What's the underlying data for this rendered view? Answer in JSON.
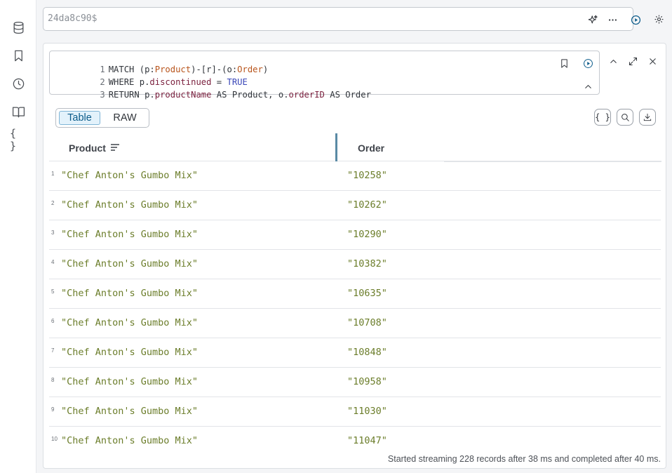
{
  "editor": {
    "value": "24da8c90$"
  },
  "query": {
    "lines": [
      {
        "n": "1",
        "parts": [
          {
            "t": "MATCH (p:",
            "c": "kw"
          },
          {
            "t": "Product",
            "c": "lbl"
          },
          {
            "t": ")-[r]-(o:",
            "c": "kw"
          },
          {
            "t": "Order",
            "c": "lbl"
          },
          {
            "t": ")",
            "c": "kw"
          }
        ]
      },
      {
        "n": "2",
        "parts": [
          {
            "t": "WHERE p.",
            "c": "kw"
          },
          {
            "t": "discontinued",
            "c": "prop"
          },
          {
            "t": " = ",
            "c": "kw"
          },
          {
            "t": "TRUE",
            "c": "bool"
          }
        ]
      },
      {
        "n": "3",
        "parts": [
          {
            "t": "RETURN p.",
            "c": "kw"
          },
          {
            "t": "productName",
            "c": "prop"
          },
          {
            "t": " AS Product, o.",
            "c": "kw"
          },
          {
            "t": "orderID",
            "c": "prop"
          },
          {
            "t": " AS Order",
            "c": "kw"
          }
        ]
      }
    ]
  },
  "view_toggle": {
    "table_label": "Table",
    "raw_label": "RAW",
    "selected": "Table"
  },
  "table": {
    "columns": [
      "Product",
      "Order"
    ],
    "rows": [
      {
        "n": "1",
        "product": "\"Chef Anton's Gumbo Mix\"",
        "order": "\"10258\""
      },
      {
        "n": "2",
        "product": "\"Chef Anton's Gumbo Mix\"",
        "order": "\"10262\""
      },
      {
        "n": "3",
        "product": "\"Chef Anton's Gumbo Mix\"",
        "order": "\"10290\""
      },
      {
        "n": "4",
        "product": "\"Chef Anton's Gumbo Mix\"",
        "order": "\"10382\""
      },
      {
        "n": "5",
        "product": "\"Chef Anton's Gumbo Mix\"",
        "order": "\"10635\""
      },
      {
        "n": "6",
        "product": "\"Chef Anton's Gumbo Mix\"",
        "order": "\"10708\""
      },
      {
        "n": "7",
        "product": "\"Chef Anton's Gumbo Mix\"",
        "order": "\"10848\""
      },
      {
        "n": "8",
        "product": "\"Chef Anton's Gumbo Mix\"",
        "order": "\"10958\""
      },
      {
        "n": "9",
        "product": "\"Chef Anton's Gumbo Mix\"",
        "order": "\"11030\""
      },
      {
        "n": "10",
        "product": "\"Chef Anton's Gumbo Mix\"",
        "order": "\"11047\""
      }
    ]
  },
  "status": "Started streaming 228 records after 38 ms and completed after 40 ms.",
  "icons": {
    "rail": [
      "database-icon",
      "bookmark-icon",
      "history-icon",
      "book-icon",
      "braces-icon"
    ],
    "editor_bar": [
      "sparkle-icon",
      "more-icon",
      "run-icon",
      "settings-icon"
    ],
    "query": [
      "bookmark-icon",
      "run-icon",
      "collapse-icon",
      "expand-icon",
      "close-icon",
      "chevron-up-icon"
    ],
    "toolbar": [
      "braces-icon",
      "search-icon",
      "download-icon"
    ]
  },
  "colors": {
    "accent": "#0a5b8a",
    "string_value": "#6b7d2a",
    "label": "#b8541b",
    "property": "#7a1f3d",
    "boolean": "#3b47b8"
  }
}
